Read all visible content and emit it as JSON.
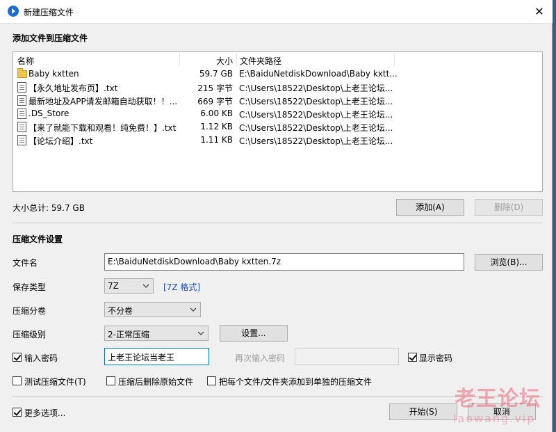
{
  "window": {
    "title": "新建压缩文件",
    "close_glyph": "✕"
  },
  "files_section": {
    "title": "添加文件到压缩文件",
    "columns": {
      "name": "名称",
      "size": "大小",
      "path": "文件夹路径"
    },
    "rows": [
      {
        "icon": "folder-icon",
        "name": "Baby kxtten",
        "size": "59.7 GB",
        "path": "E:\\BaiduNetdiskDownload\\Baby kxtt..."
      },
      {
        "icon": "text-file-icon",
        "name": "【永久地址发布页】.txt",
        "size": "215 字节",
        "path": "C:\\Users\\18522\\Desktop\\上老王论坛..."
      },
      {
        "icon": "text-file-icon",
        "name": "最新地址及APP请发邮箱自动获取！！...",
        "size": "669 字节",
        "path": "C:\\Users\\18522\\Desktop\\上老王论坛..."
      },
      {
        "icon": "file-icon",
        "name": ".DS_Store",
        "size": "6.00 KB",
        "path": "C:\\Users\\18522\\Desktop\\上老王论坛..."
      },
      {
        "icon": "text-file-icon",
        "name": "【来了就能下载和观看！纯免费！】.txt",
        "size": "1.12 KB",
        "path": "C:\\Users\\18522\\Desktop\\上老王论坛..."
      },
      {
        "icon": "text-file-icon",
        "name": "【论坛介绍】.txt",
        "size": "1.11 KB",
        "path": "C:\\Users\\18522\\Desktop\\上老王论坛..."
      }
    ],
    "total_size": "大小总计: 59.7 GB",
    "add_label": "添加(A)",
    "delete_label": "删除(D)"
  },
  "settings": {
    "title": "压缩文件设置",
    "filename_label": "文件名",
    "filename_value": "E:\\BaiduNetdiskDownload\\Baby kxtten.7z",
    "browse_label": "浏览(B)...",
    "type_label": "保存类型",
    "type_value": "7Z",
    "type_link": "[7Z 格式]",
    "split_label": "压缩分卷",
    "split_value": "不分卷",
    "level_label": "压缩级别",
    "level_value": "2-正常压缩",
    "settings_button": "设置...",
    "password_checkbox": "输入密码",
    "password_value": "上老王论坛当老王",
    "repeat_password_label": "再次输入密码",
    "show_password": "显示密码",
    "test_archive": "测试压缩文件(T)",
    "delete_after": "压缩后删除原始文件",
    "separate_archives": "把每个文件/文件夹添加到单独的压缩文件"
  },
  "footer": {
    "more_options": "更多选项...",
    "start_label": "开始(S)",
    "cancel_label": "取消"
  },
  "watermark": {
    "cn": "老王论坛",
    "en": "laowang.vip"
  }
}
